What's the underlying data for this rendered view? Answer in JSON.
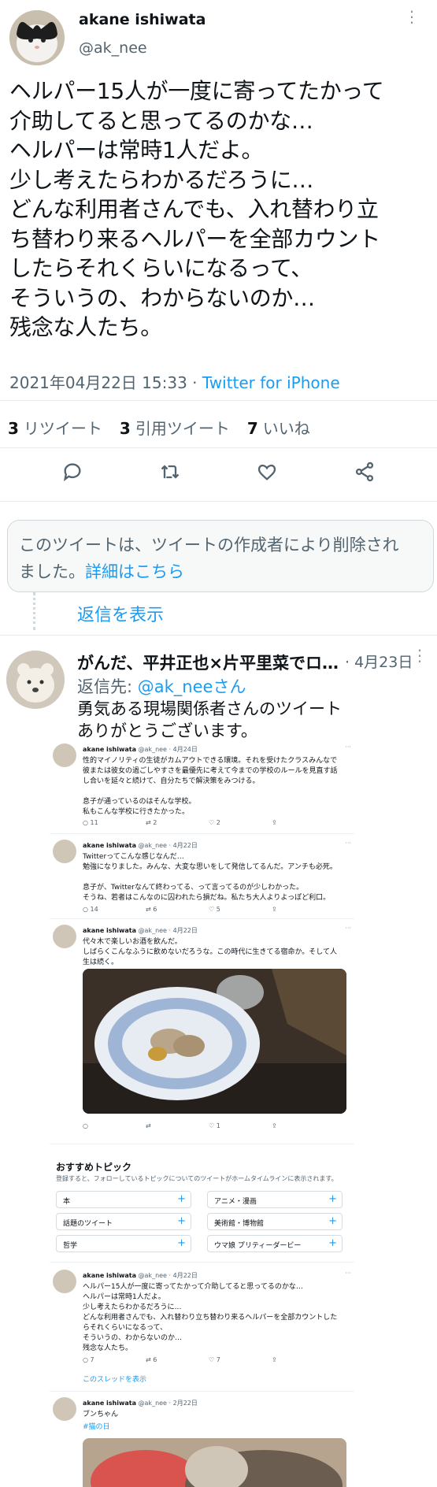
{
  "main_tweet": {
    "author_name": "akane ishiwata",
    "handle": "@ak_nee",
    "text": "ヘルパー15人が一度に寄ってたかって\n介助してると思ってるのかな…\nヘルパーは常時1人だよ。\n少し考えたらわかるだろうに…\nどんな利用者さんでも、入れ替わり立\nち替わり来るヘルパーを全部カウント\nしたらそれくらいになるって、\nそういうの、わからないのか…\n残念な人たち。",
    "timestamp": "2021年04月22日 15:33",
    "meta_separator": "·",
    "source": "Twitter for iPhone",
    "stats": {
      "retweets_count": "3",
      "retweets_label": "リツイート",
      "quotes_count": "3",
      "quotes_label": "引用ツイート",
      "likes_count": "7",
      "likes_label": "いいね"
    },
    "actions": [
      "reply-icon",
      "retweet-icon",
      "like-icon",
      "share-icon"
    ]
  },
  "deleted_notice": {
    "text": "このツイートは、ツイートの作成者により削除され\nました。",
    "link": "詳細はこちら"
  },
  "show_replies": "返信を表示",
  "reply": {
    "author_name": "がんだ、平井正也×片平里菜でロ…",
    "date": "4月23日",
    "reply_to_label": "返信先:",
    "reply_to_handle": "@ak_neeさん",
    "text": "勇気ある現場関係者さんのツイート\nありがとうございます。"
  },
  "embedded": {
    "tweets": [
      {
        "name": "akane ishiwata",
        "handle": "@ak_nee",
        "date": "4月24日",
        "text": "性的マイノリティの生徒がカムアウトできる環境。それを受けたクラスみんなで\n彼または彼女の過ごしやすさを最優先に考えて今までの学校のルールを見直す話\nし合いを延々と続けて、自分たちで解決策をみつける。\n\n息子が通っているのはそんな学校。\n私もこんな学校に行きたかった。",
        "replies": "11",
        "retweets": "2",
        "likes": "2"
      },
      {
        "name": "akane ishiwata",
        "handle": "@ak_nee",
        "date": "4月22日",
        "text": "Twitterってこんな感じなんだ…\n勉強になりました。みんな、大変な思いをして発信してるんだ。アンチも必死。\n\n息子が、Twitterなんて終わってる、って言ってるのが少しわかった。\nそうね、若者はこんなのに囚われたら損だね。私たち大人よりよっぽど利口。",
        "replies": "14",
        "retweets": "6",
        "likes": "5"
      },
      {
        "name": "akane ishiwata",
        "handle": "@ak_nee",
        "date": "4月22日",
        "text": "代々木で楽しいお酒を飲んだ。\nしばらくこんなふうに飲めないだろうな。この時代に生きてる宿命か。そして人\n生は続く。",
        "replies": "",
        "retweets": "",
        "likes": "1"
      }
    ],
    "topics": {
      "title": "おすすめトピック",
      "subtitle": "登録すると、フォローしているトピックについてのツイートがホームタイムラインに表示されます。",
      "items": [
        "本",
        "アニメ・漫画",
        "話題のツイート",
        "美術館・博物館",
        "哲学",
        "ウマ娘 プリティーダービー"
      ]
    },
    "tweet4": {
      "name": "akane ishiwata",
      "handle": "@ak_nee",
      "date": "4月22日",
      "text": "ヘルパー15人が一度に寄ってたかって介助してると思ってるのかな…\nヘルパーは常時1人だよ。\n少し考えたらわかるだろうに…\nどんな利用者さんでも、入れ替わり立ち替わり来るヘルパーを全部カウントした\nらそれくらいになるって、\nそういうの、わからないのか…\n残念な人たち。",
      "replies": "7",
      "retweets": "6",
      "likes": "7",
      "thread_link": "このスレッドを表示"
    },
    "tweet5": {
      "name": "akane ishiwata",
      "handle": "@ak_nee",
      "date": "2月22日",
      "text": "ブンちゃん",
      "hashtag": "#猫の日"
    }
  }
}
